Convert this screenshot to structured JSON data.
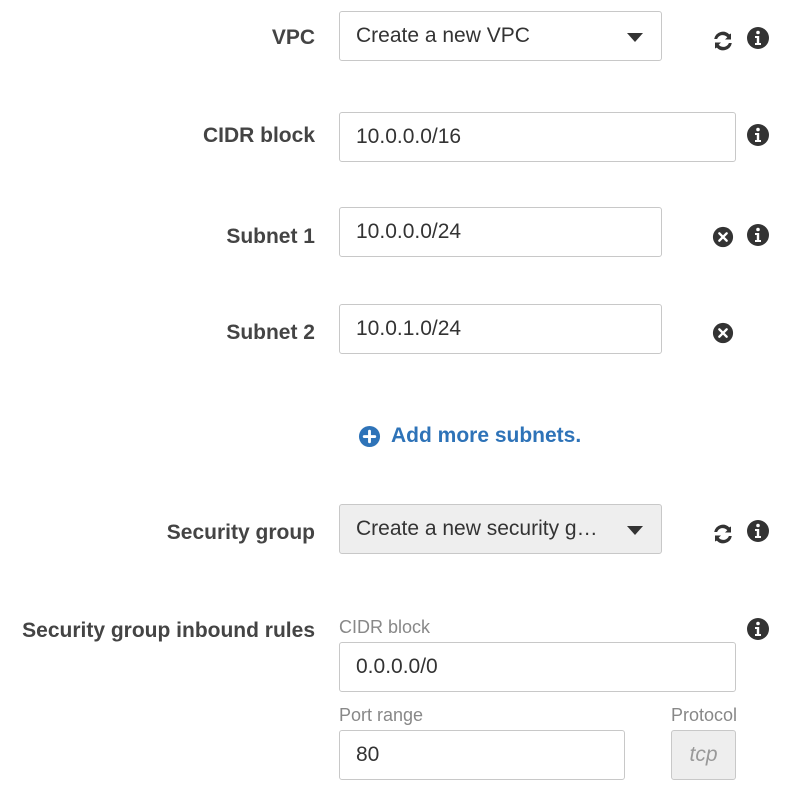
{
  "vpc": {
    "label": "VPC",
    "selected": "Create a new VPC"
  },
  "cidr": {
    "label": "CIDR block",
    "value": "10.0.0.0/16"
  },
  "subnets": [
    {
      "label": "Subnet 1",
      "value": "10.0.0.0/24"
    },
    {
      "label": "Subnet 2",
      "value": "10.0.1.0/24"
    }
  ],
  "add_subnets": {
    "label": "Add more subnets."
  },
  "security_group": {
    "label": "Security group",
    "selected": "Create a new security g…"
  },
  "inbound_rules": {
    "label": "Security group inbound rules",
    "cidr_label": "CIDR block",
    "cidr_value": "0.0.0.0/0",
    "port_label": "Port range",
    "port_value": "80",
    "protocol_label": "Protocol",
    "protocol_value": "tcp"
  },
  "icons": {
    "refresh": "refresh-icon",
    "info": "info-icon",
    "remove": "remove-icon",
    "add": "plus-circle-icon"
  },
  "colors": {
    "link": "#2e73b8",
    "icon": "#333333",
    "disabled_bg": "#eeeeee"
  }
}
